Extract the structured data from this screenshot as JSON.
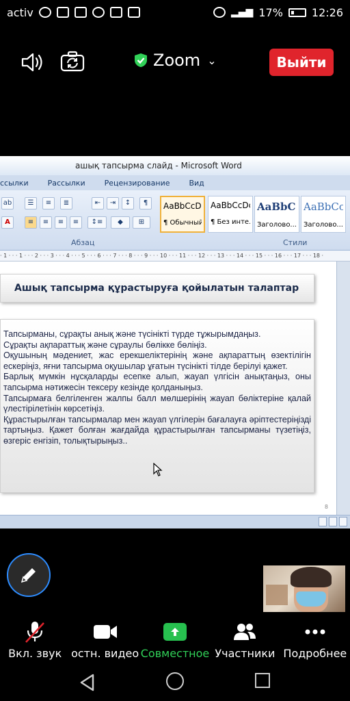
{
  "status_bar": {
    "carrier": "activ",
    "battery": "17%",
    "time": "12:26"
  },
  "meeting": {
    "title": "Zoom",
    "leave_label": "Выйти",
    "colors": {
      "leave": "#e0242c",
      "secure": "#31d158",
      "share": "#27c04f",
      "annotate_ring": "#2d8cff"
    }
  },
  "word": {
    "window_title": "ашық тапсырма слайд - Microsoft Word",
    "tabs": [
      "ссылки",
      "Рассылки",
      "Рецензирование",
      "Вид"
    ],
    "groups": {
      "paragraph": "Абзац",
      "styles": "Стили"
    },
    "styles": [
      {
        "sample": "AaBbCcDc",
        "name": "¶ Обычный"
      },
      {
        "sample": "AaBbCcDc",
        "name": "¶ Без инте..."
      },
      {
        "sample": "AaBbC",
        "name": "Заголово..."
      },
      {
        "sample": "AaBbCc",
        "name": "Заголово..."
      }
    ],
    "ruler": "· 1 · · · 1 · · · 2 · · · 3 · · · 4 · · · 5 · · · 6 · · · 7 · · · 8 · · · 9 · · · 10 · · · 11 · · · 12 · · · 13 · · · 14 · · · 15 · · · 16 · · · 17 · · · 18 ·",
    "page_number": "8",
    "slide_heading": "Ашық тапсырма құрастыруға қойылатын талаптар",
    "slide_paragraphs": [
      "Тапсырманы, сұрақты анық және түсінікті түрде тұжырымдаңыз.",
      "Сұрақты ақпараттық және сұраулы бөлікке бөліңіз.",
      "Оқушының мәдениет, жас ерекшеліктерінің және ақпараттың өзектілігін ескеріңіз, яғни тапсырма оқушылар ұғатын түсінікті тілде берілуі қажет.",
      "Барлық мүмкін нұсқаларды есепке алып, жауап үлгісін анықтаңыз, оны тапсырма нәтижесін тексеру кезінде қолданыңыз.",
      "Тапсырмаға белгіленген жалпы балл мөлшерінің жауап бөліктеріне қалай үлестірілетінін көрсетіңіз.",
      "Құрастырылған тапсырмалар мен жауап үлгілерін бағалауға әріптестеріңізді тартыңыз. Қажет болған жағдайда құрастырылған тапсырманы түзетіңіз, өзгеріс енгізіп, толықтырыңыз.."
    ]
  },
  "toolbar": {
    "mute_label": "Вкл. звук",
    "video_label": "остн. видео",
    "share_label": "Совместное",
    "participants_label": "Участники",
    "more_label": "Подробнее"
  }
}
